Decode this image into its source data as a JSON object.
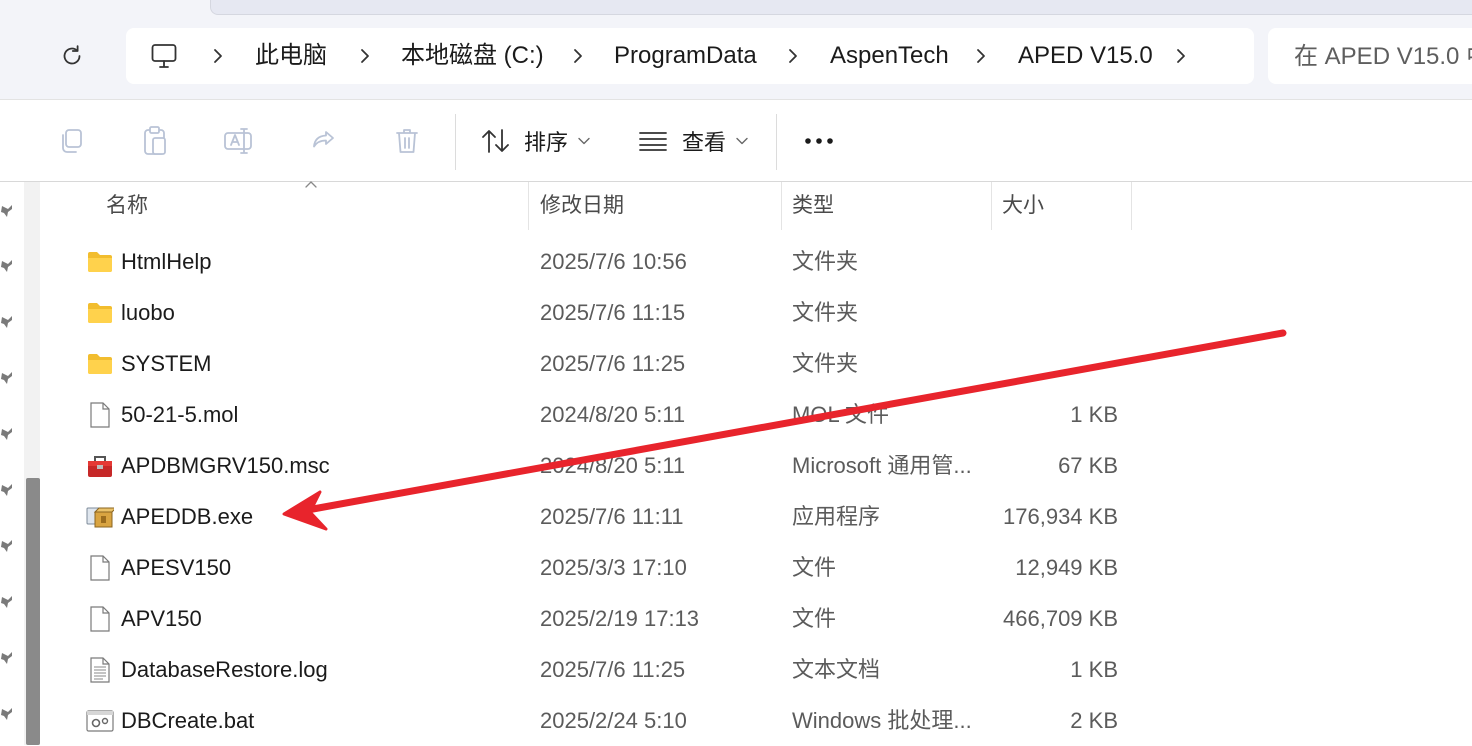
{
  "address": {
    "refresh_icon": "refresh-icon",
    "computer_icon": "computer-icon",
    "breadcrumbs": [
      "此电脑",
      "本地磁盘 (C:)",
      "ProgramData",
      "AspenTech",
      "APED V15.0"
    ],
    "search_placeholder": "在 APED V15.0 中"
  },
  "toolbar": {
    "icons": [
      "copy-icon",
      "paste-icon",
      "rename-icon",
      "share-icon",
      "delete-icon"
    ],
    "sort_label": "排序",
    "view_label": "查看",
    "more_icon": "more-icon"
  },
  "columns": {
    "name": "名称",
    "date": "修改日期",
    "type": "类型",
    "size": "大小"
  },
  "files": [
    {
      "name": "HtmlHelp",
      "date": "2025/7/6 10:56",
      "type": "文件夹",
      "size": "",
      "icon": "folder"
    },
    {
      "name": "luobo",
      "date": "2025/7/6 11:15",
      "type": "文件夹",
      "size": "",
      "icon": "folder"
    },
    {
      "name": "SYSTEM",
      "date": "2025/7/6 11:25",
      "type": "文件夹",
      "size": "",
      "icon": "folder"
    },
    {
      "name": "50-21-5.mol",
      "date": "2024/8/20 5:11",
      "type": "MOL 文件",
      "size": "1 KB",
      "icon": "file"
    },
    {
      "name": "APDBMGRV150.msc",
      "date": "2024/8/20 5:11",
      "type": "Microsoft 通用管...",
      "size": "67 KB",
      "icon": "toolbox"
    },
    {
      "name": "APEDDB.exe",
      "date": "2025/7/6 11:11",
      "type": "应用程序",
      "size": "176,934 KB",
      "icon": "exe"
    },
    {
      "name": "APESV150",
      "date": "2025/3/3 17:10",
      "type": "文件",
      "size": "12,949 KB",
      "icon": "file"
    },
    {
      "name": "APV150",
      "date": "2025/2/19 17:13",
      "type": "文件",
      "size": "466,709 KB",
      "icon": "file"
    },
    {
      "name": "DatabaseRestore.log",
      "date": "2025/7/6 11:25",
      "type": "文本文档",
      "size": "1 KB",
      "icon": "text"
    },
    {
      "name": "DBCreate.bat",
      "date": "2025/2/24 5:10",
      "type": "Windows 批处理...",
      "size": "2 KB",
      "icon": "bat"
    }
  ],
  "annotation": {
    "color": "#e8242c",
    "target": "APEDDB.exe"
  },
  "colors": {
    "folder": "#f4c430",
    "annotation_arrow": "#e8242c"
  }
}
